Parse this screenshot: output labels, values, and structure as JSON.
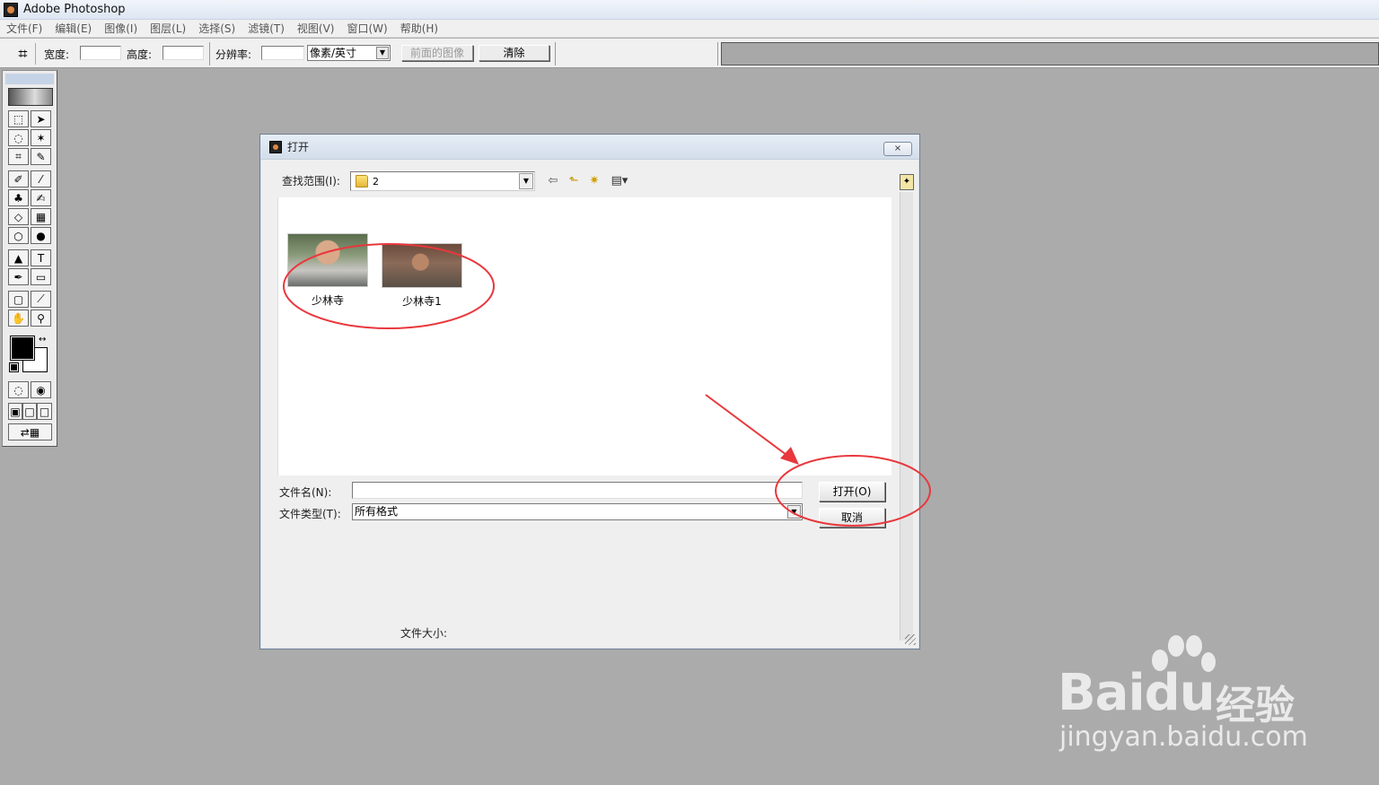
{
  "app": {
    "title": "Adobe Photoshop"
  },
  "menu": [
    "文件(F)",
    "编辑(E)",
    "图像(I)",
    "图层(L)",
    "选择(S)",
    "滤镜(T)",
    "视图(V)",
    "窗口(W)",
    "帮助(H)"
  ],
  "options": {
    "width_label": "宽度:",
    "height_label": "高度:",
    "resolution_label": "分辨率:",
    "unit_value": "像素/英寸",
    "front_image_button": "前面的图像",
    "clear_button": "清除"
  },
  "dialog": {
    "title": "打开",
    "close_symbol": "×",
    "look_in_label": "查找范围(I):",
    "look_in_value": "2",
    "files": [
      {
        "name": "少林寺"
      },
      {
        "name": "少林寺1"
      }
    ],
    "filename_label": "文件名(N):",
    "filename_value": "",
    "filetype_label": "文件类型(T):",
    "filetype_value": "所有格式",
    "open_button": "打开(O)",
    "cancel_button": "取消",
    "filesize_label": "文件大小:"
  },
  "annotation_color": "#e8383d",
  "watermark": {
    "brand": "Bai",
    "brand_suffix": "du",
    "product": "经验",
    "url": "jingyan.baidu.com"
  }
}
